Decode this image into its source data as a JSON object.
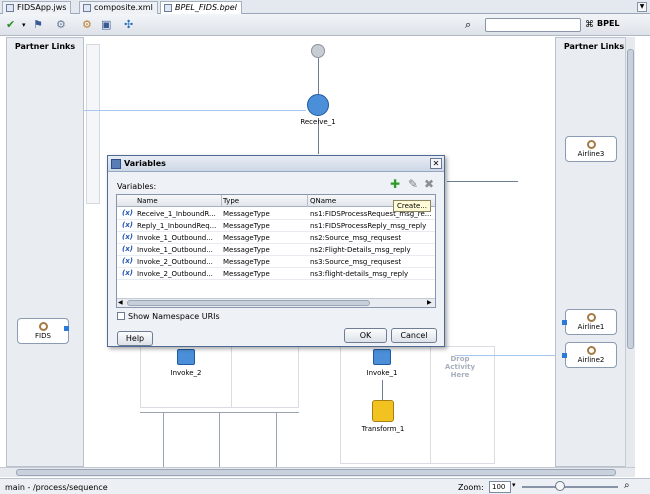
{
  "tabs": [
    {
      "label": "FIDSApp.jws",
      "active": false
    },
    {
      "label": "composite.xml",
      "active": false
    },
    {
      "label": "BPEL_FIDS.bpel",
      "active": true
    }
  ],
  "toolbar": {
    "search_icon": "binoculars-icon",
    "bpel_label": "BPEL"
  },
  "partner_links": {
    "left_title": "Partner Links",
    "right_title": "Partner Links",
    "left": [
      {
        "label": "FIDS"
      }
    ],
    "right": [
      {
        "label": "Airline3"
      },
      {
        "label": "Airline1"
      },
      {
        "label": "Airline2"
      }
    ]
  },
  "canvas": {
    "receive_label": "Receive_1",
    "invoke_left_label": "Invoke_2",
    "invoke_right_label": "Invoke_1",
    "transform_label": "Transform_1",
    "drop_activity": "Drop Activity Here"
  },
  "dialog": {
    "title": "Variables",
    "variables_label": "Variables:",
    "tooltip": "Create...",
    "columns": [
      "Name",
      "Type",
      "QName"
    ],
    "rows": [
      {
        "name": "Receive_1_InboundR...",
        "type": "MessageType",
        "qname": "ns1:FIDSProcessRequest_msg_re..."
      },
      {
        "name": "Reply_1_InboundReq...",
        "type": "MessageType",
        "qname": "ns1:FIDSProcessReply_msg_reply"
      },
      {
        "name": "Invoke_1_Outbound...",
        "type": "MessageType",
        "qname": "ns2:Source_msg_requsest"
      },
      {
        "name": "Invoke_1_Outbound...",
        "type": "MessageType",
        "qname": "ns2:Flight-Details_msg_reply"
      },
      {
        "name": "Invoke_2_Outbound...",
        "type": "MessageType",
        "qname": "ns3:Source_msg_requsest"
      },
      {
        "name": "Invoke_2_Outbound...",
        "type": "MessageType",
        "qname": "ns3:flight-details_msg_reply"
      }
    ],
    "show_namespace": "Show Namespace URIs",
    "help": "Help",
    "ok": "OK",
    "cancel": "Cancel"
  },
  "statusbar": {
    "path": "main - /process/sequence",
    "zoom_label": "Zoom:",
    "zoom_value": "100"
  }
}
